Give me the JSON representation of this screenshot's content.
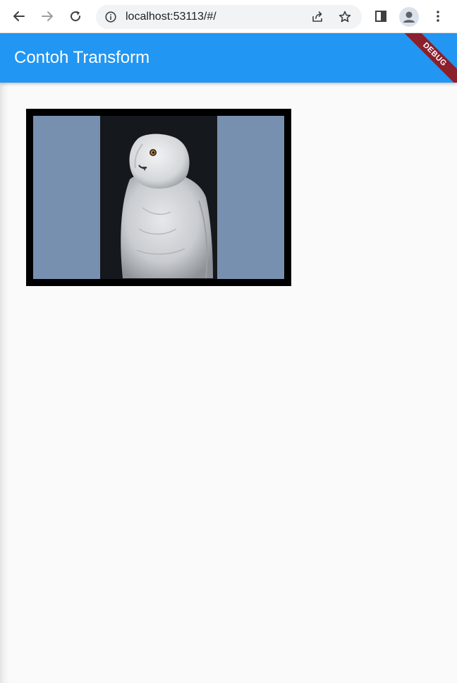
{
  "browser": {
    "url": "localhost:53113/#/",
    "icons": {
      "back": "arrow-left-icon",
      "forward": "arrow-right-icon",
      "reload": "reload-icon",
      "site_info": "info-icon",
      "share": "share-icon",
      "bookmark": "star-icon",
      "side_panel": "side-panel-icon",
      "profile": "profile-icon",
      "menu": "kebab-menu-icon"
    }
  },
  "app": {
    "title": "Contoh Transform",
    "debug_banner": "DEBUG",
    "colors": {
      "app_bar": "#2196f3",
      "background": "#fafafa",
      "frame": "#000000",
      "panel": "#7890b0",
      "debug_ribbon": "#8b1f2b"
    },
    "image": {
      "subject": "snowy-owl-photo"
    }
  }
}
